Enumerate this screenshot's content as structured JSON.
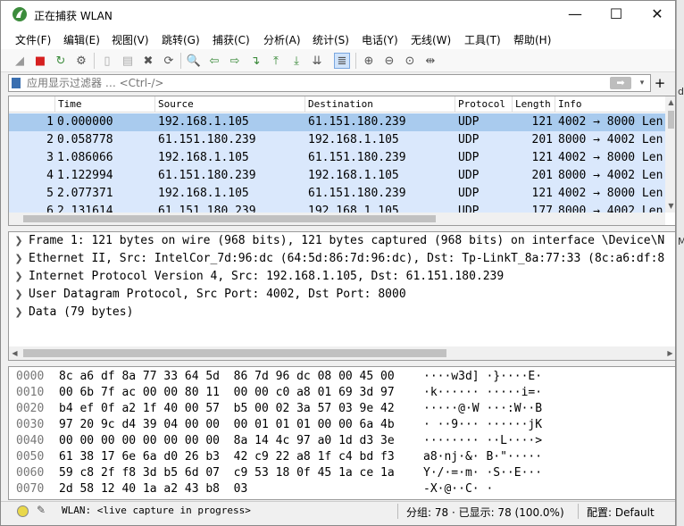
{
  "window": {
    "title": "正在捕获 WLAN",
    "controls": {
      "minimize": "—",
      "maximize": "☐",
      "close": "✕"
    }
  },
  "menu": [
    "文件(F)",
    "编辑(E)",
    "视图(V)",
    "跳转(G)",
    "捕获(C)",
    "分析(A)",
    "统计(S)",
    "电话(Y)",
    "无线(W)",
    "工具(T)",
    "帮助(H)"
  ],
  "toolbar": {
    "icons": [
      "shark-fin-start-icon",
      "stop-capture-icon",
      "restart-capture-icon",
      "capture-options-icon",
      "open-file-icon",
      "save-file-icon",
      "close-file-icon",
      "reload-file-icon",
      "find-packet-icon",
      "go-back-icon",
      "go-forward-icon",
      "go-to-packet-icon",
      "first-packet-icon",
      "last-packet-icon",
      "autoscroll-icon",
      "colorize-icon",
      "zoom-in-icon",
      "zoom-out-icon",
      "zoom-normal-icon",
      "resize-columns-icon"
    ],
    "glyphs": [
      "◢",
      "■",
      "↻",
      "⚙",
      "▯",
      "▤",
      "✖",
      "⟳",
      "🔍",
      "⇦",
      "⇨",
      "↴",
      "⤒",
      "⤓",
      "⇊",
      "≣",
      "⊕",
      "⊖",
      "⊙",
      "⇹"
    ]
  },
  "filter": {
    "placeholder": "应用显示过滤器 … <Ctrl-/>",
    "apply_glyph": "➡",
    "dropdown_glyph": "▾",
    "add_glyph": "+"
  },
  "packet_list": {
    "columns": [
      "Time",
      "Source",
      "Destination",
      "Protocol",
      "Length",
      "Info"
    ],
    "rows": [
      {
        "no": "1",
        "time": "0.000000",
        "src": "192.168.1.105",
        "dst": "61.151.180.239",
        "proto": "UDP",
        "len": "121",
        "info": "4002 → 8000 Len"
      },
      {
        "no": "2",
        "time": "0.058778",
        "src": "61.151.180.239",
        "dst": "192.168.1.105",
        "proto": "UDP",
        "len": "201",
        "info": "8000 → 4002 Len"
      },
      {
        "no": "3",
        "time": "1.086066",
        "src": "192.168.1.105",
        "dst": "61.151.180.239",
        "proto": "UDP",
        "len": "121",
        "info": "4002 → 8000 Len"
      },
      {
        "no": "4",
        "time": "1.122994",
        "src": "61.151.180.239",
        "dst": "192.168.1.105",
        "proto": "UDP",
        "len": "201",
        "info": "8000 → 4002 Len"
      },
      {
        "no": "5",
        "time": "2.077371",
        "src": "192.168.1.105",
        "dst": "61.151.180.239",
        "proto": "UDP",
        "len": "121",
        "info": "4002 → 8000 Len"
      },
      {
        "no": "6",
        "time": "2.131614",
        "src": "61.151.180.239",
        "dst": "192.168.1.105",
        "proto": "UDP",
        "len": "177",
        "info": "8000 → 4002 Len"
      }
    ]
  },
  "details": [
    "Frame 1: 121 bytes on wire (968 bits), 121 bytes captured (968 bits) on interface \\Device\\N",
    "Ethernet II, Src: IntelCor_7d:96:dc (64:5d:86:7d:96:dc), Dst: Tp-LinkT_8a:77:33 (8c:a6:df:8",
    "Internet Protocol Version 4, Src: 192.168.1.105, Dst: 61.151.180.239",
    "User Datagram Protocol, Src Port: 4002, Dst Port: 8000",
    "Data (79 bytes)"
  ],
  "bytes": [
    {
      "off": "0000",
      "hex": "8c a6 df 8a 77 33 64 5d  86 7d 96 dc 08 00 45 00",
      "ascii": "····w3d] ·}····E·"
    },
    {
      "off": "0010",
      "hex": "00 6b 7f ac 00 00 80 11  00 00 c0 a8 01 69 3d 97",
      "ascii": "·k······ ·····i=·"
    },
    {
      "off": "0020",
      "hex": "b4 ef 0f a2 1f 40 00 57  b5 00 02 3a 57 03 9e 42",
      "ascii": "·····@·W ···:W··B"
    },
    {
      "off": "0030",
      "hex": "97 20 9c d4 39 04 00 00  00 01 01 01 00 00 6a 4b",
      "ascii": "· ··9··· ······jK"
    },
    {
      "off": "0040",
      "hex": "00 00 00 00 00 00 00 00  8a 14 4c 97 a0 1d d3 3e",
      "ascii": "········ ··L····>"
    },
    {
      "off": "0050",
      "hex": "61 38 17 6e 6a d0 26 b3  42 c9 22 a8 1f c4 bd f3",
      "ascii": "a8·nj·&· B·\"·····"
    },
    {
      "off": "0060",
      "hex": "59 c8 2f f8 3d b5 6d 07  c9 53 18 0f 45 1a ce 1a",
      "ascii": "Y·/·=·m· ·S··E···"
    },
    {
      "off": "0070",
      "hex": "2d 58 12 40 1a a2 43 b8  03",
      "ascii": "-X·@··C· ·"
    }
  ],
  "status": {
    "capture_text": "WLAN: <live capture in progress>",
    "packets_text": "分组: 78 · 已显示: 78 (100.0%)",
    "profile_text": "配置: Default"
  },
  "background_fragments": [
    "d",
    "M"
  ],
  "colors": {
    "selected_row": "#a9cbee",
    "udp_row": "#dae8fc",
    "status_led": "#e9d84a",
    "logo": "#3c8c3c"
  }
}
